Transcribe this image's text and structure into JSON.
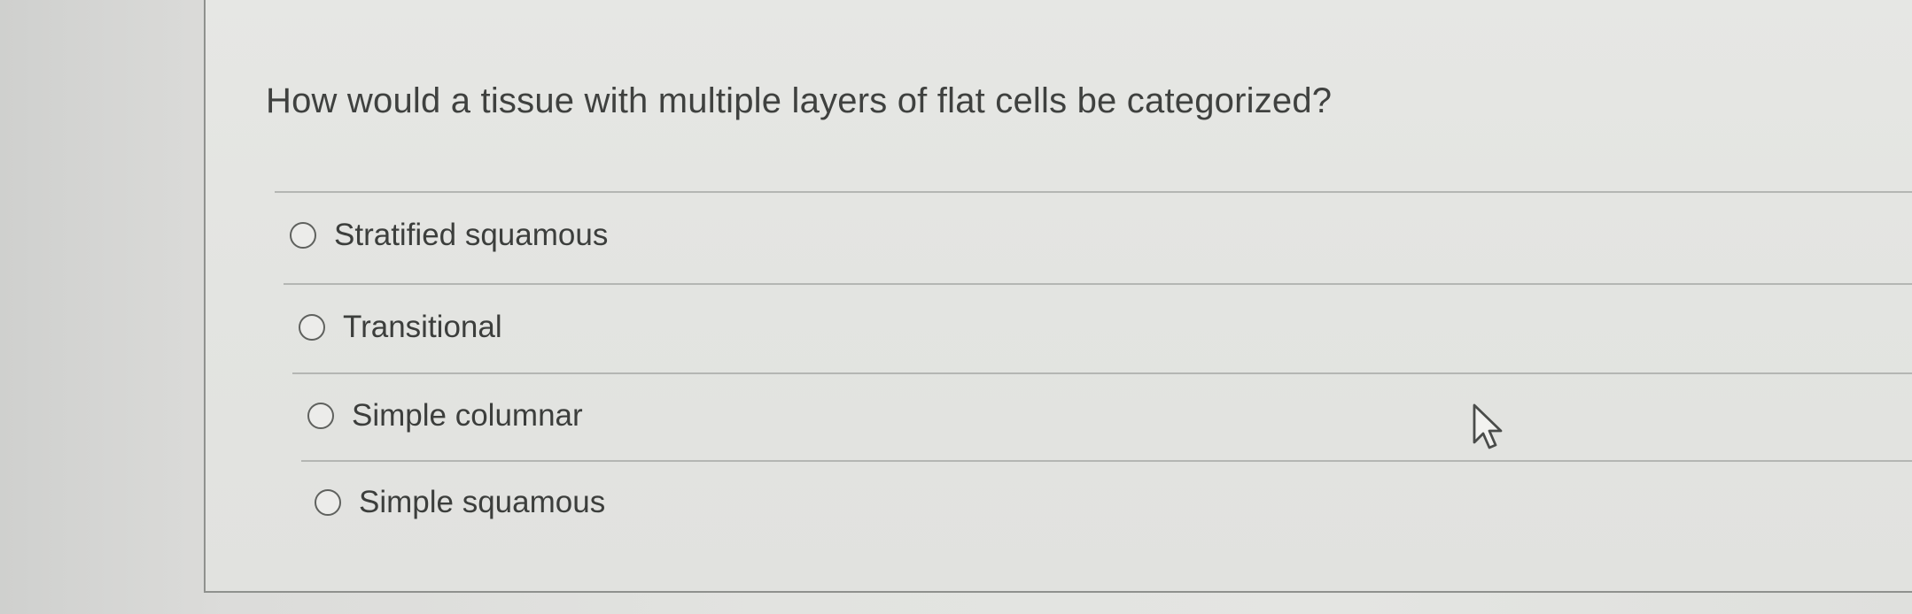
{
  "question": {
    "text": "How would a tissue with multiple layers of flat cells be categorized?"
  },
  "options": [
    {
      "label": "Stratified squamous",
      "selected": false
    },
    {
      "label": "Transitional",
      "selected": false
    },
    {
      "label": "Simple columnar",
      "selected": false
    },
    {
      "label": "Simple squamous",
      "selected": false
    }
  ],
  "icons": {
    "radio": "radio-unchecked-icon",
    "cursor": "mouse-pointer-icon"
  }
}
